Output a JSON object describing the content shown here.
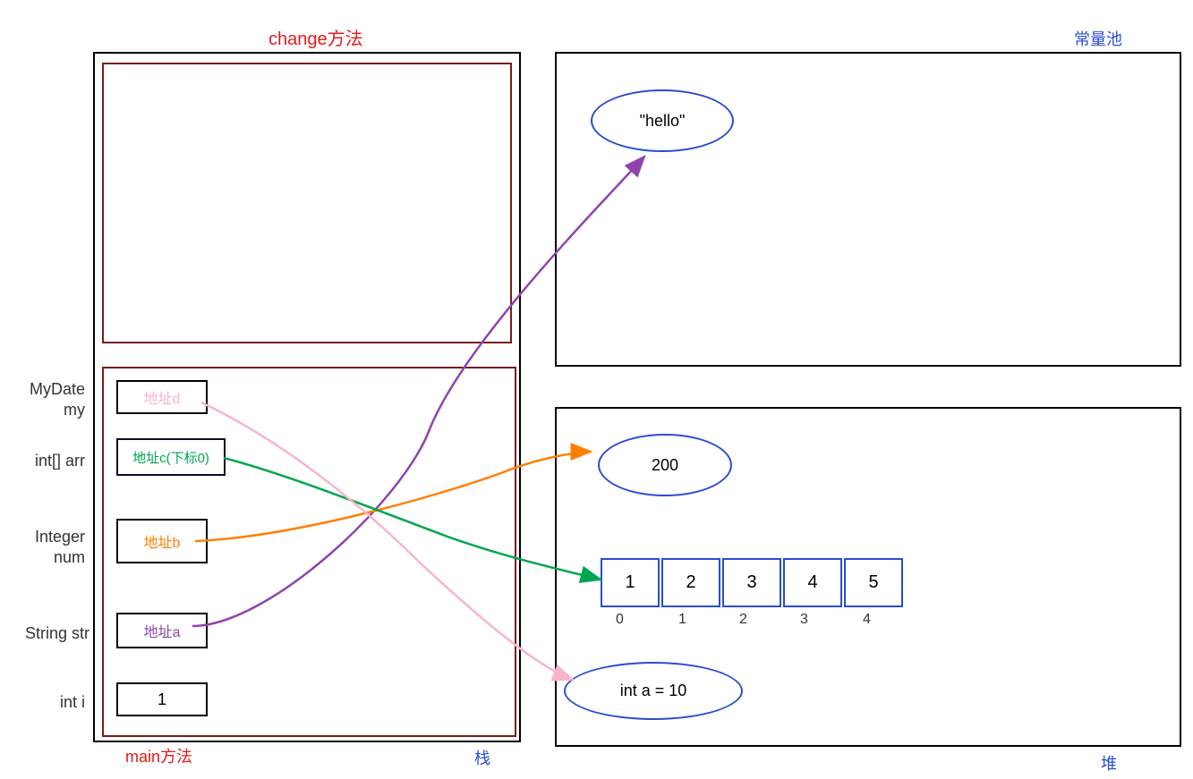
{
  "titles": {
    "change": "change方法",
    "main": "main方法",
    "stack": "栈",
    "constantPool": "常量池",
    "heap": "堆"
  },
  "stackLabels": {
    "mydate_line1": "MyDate",
    "mydate_line2": "my",
    "intarr": "int[] arr",
    "integer_line1": "Integer",
    "integer_line2": "num",
    "stringstr": "String str",
    "inti": "int i"
  },
  "stackBoxes": {
    "addr_d": "地址d",
    "addr_c": "地址c(下标0)",
    "addr_b": "地址b",
    "addr_a": "地址a",
    "val_i": "1"
  },
  "constantPool": {
    "hello": "\"hello\""
  },
  "heap": {
    "val200": "200",
    "inta": "int a = 10",
    "array": {
      "values": [
        "1",
        "2",
        "3",
        "4",
        "5"
      ],
      "indices": [
        "0",
        "1",
        "2",
        "3",
        "4"
      ]
    }
  }
}
